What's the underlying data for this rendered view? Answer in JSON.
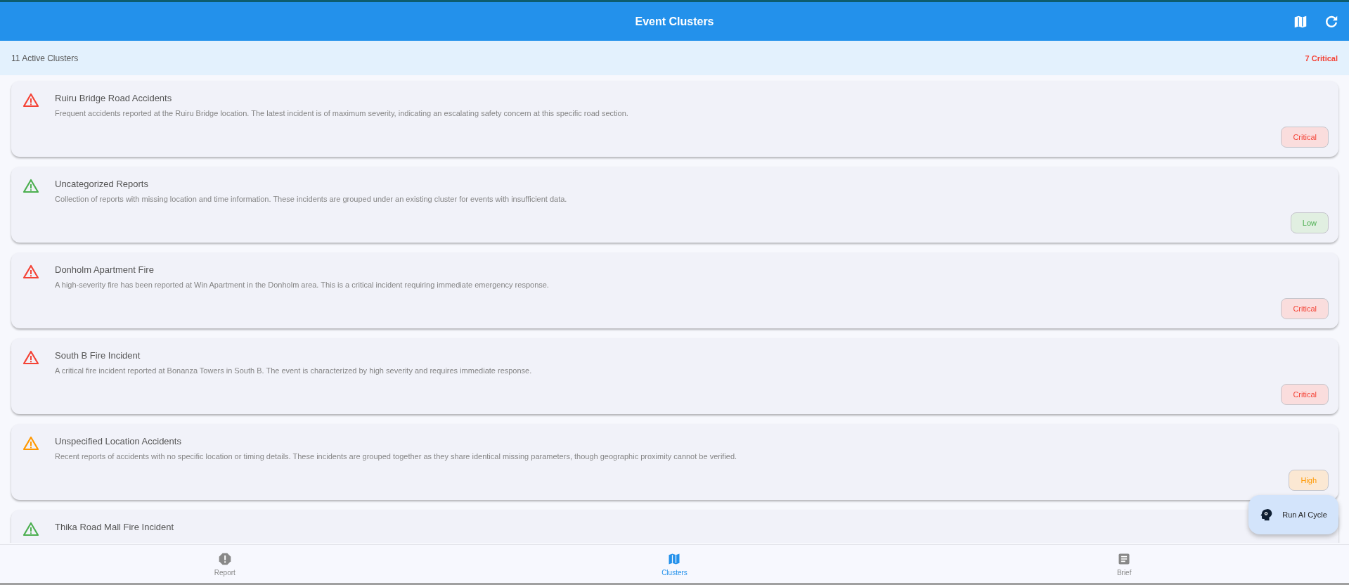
{
  "app_bar": {
    "title": "Event Clusters"
  },
  "summary": {
    "active": "11 Active Clusters",
    "critical": "7 Critical"
  },
  "clusters": [
    {
      "title": "Ruiru Bridge Road Accidents",
      "description": "Frequent accidents reported at the Ruiru Bridge location. The latest incident is of maximum severity, indicating an escalating safety concern at this specific road section.",
      "kind": "critical",
      "badge": "Critical"
    },
    {
      "title": "Uncategorized Reports",
      "description": "Collection of reports with missing location and time information. These incidents are grouped under an existing cluster for events with insufficient data.",
      "kind": "low",
      "badge": "Low"
    },
    {
      "title": "Donholm Apartment Fire",
      "description": "A high-severity fire has been reported at Win Apartment in the Donholm area. This is a critical incident requiring immediate emergency response.",
      "kind": "critical",
      "badge": "Critical"
    },
    {
      "title": "South B Fire Incident",
      "description": "A critical fire incident reported at Bonanza Towers in South B. The event is characterized by high severity and requires immediate response.",
      "kind": "critical",
      "badge": "Critical"
    },
    {
      "title": "Unspecified Location Accidents",
      "description": "Recent reports of accidents with no specific location or timing details. These incidents are grouped together as they share identical missing parameters, though geographic proximity cannot be verified.",
      "kind": "high",
      "badge": "High"
    },
    {
      "title": "Thika Road Mall Fire Incident",
      "kind": "low"
    }
  ],
  "fab": {
    "label": "Run AI Cycle"
  },
  "nav": [
    {
      "label": "Report",
      "kind": "report",
      "selected": false
    },
    {
      "label": "Clusters",
      "kind": "clusters",
      "selected": true
    },
    {
      "label": "Brief",
      "kind": "brief",
      "selected": false
    }
  ]
}
